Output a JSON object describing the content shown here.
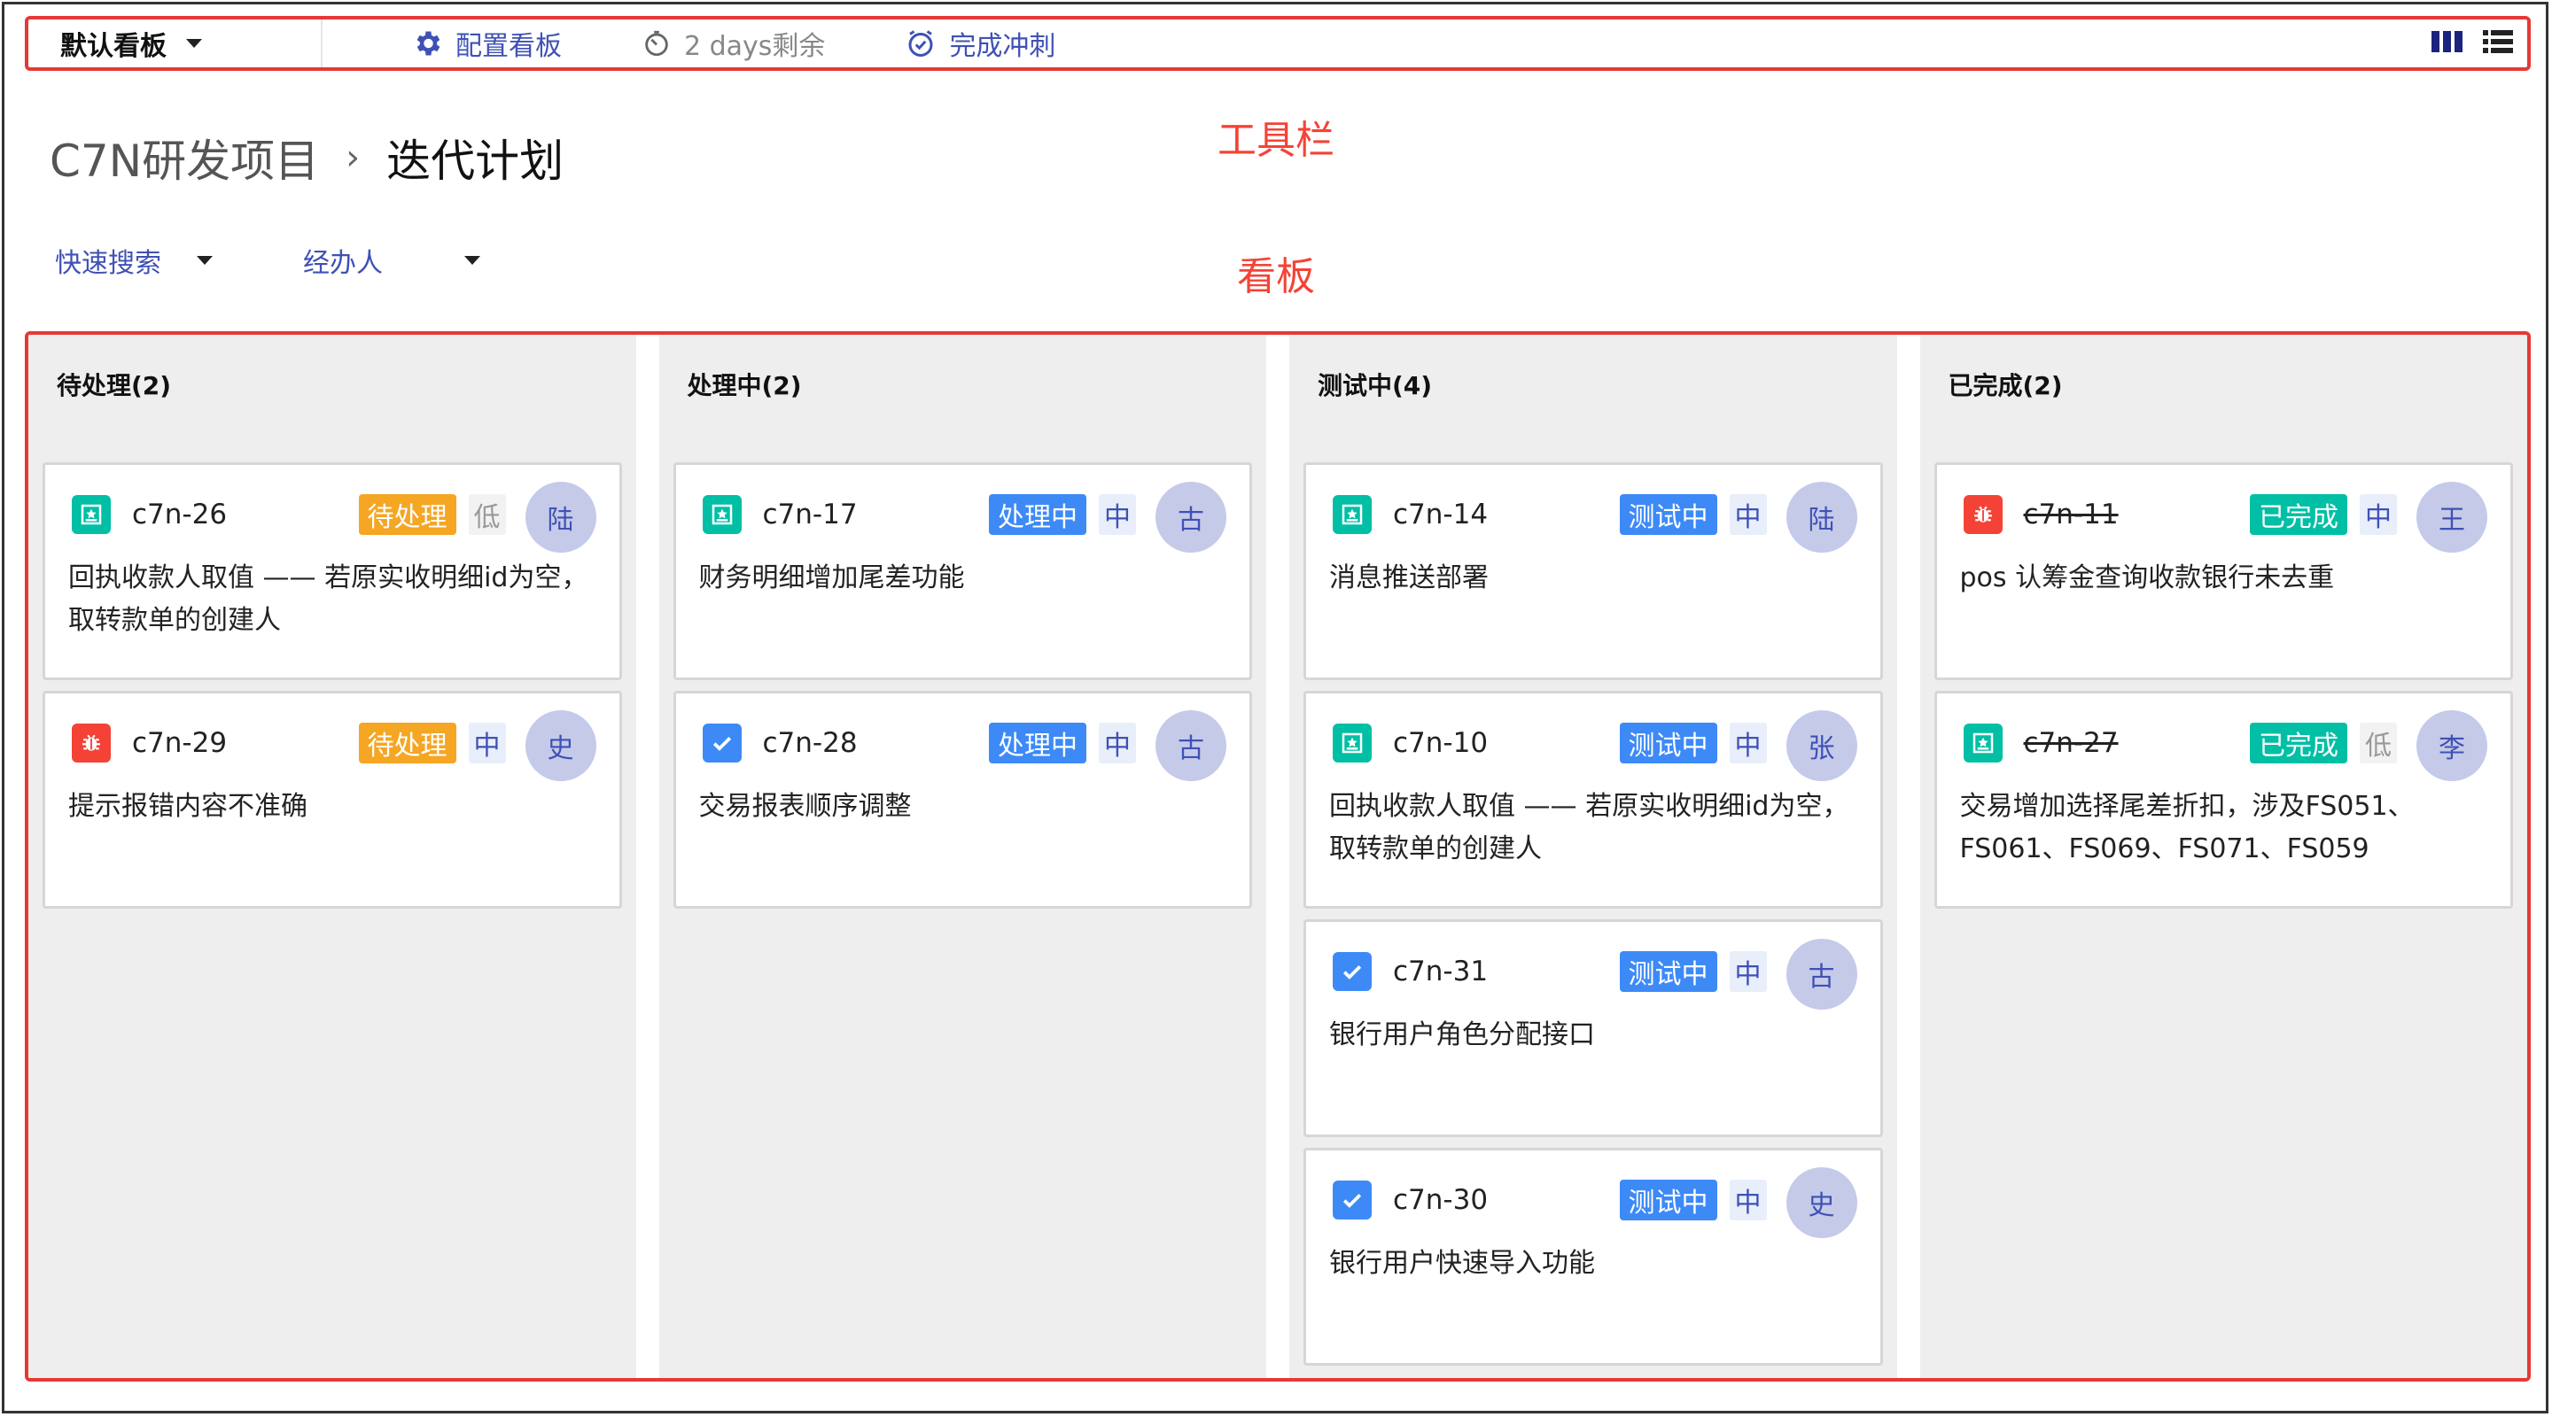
{
  "toolbar": {
    "board_select": "默认看板",
    "configure": "配置看板",
    "remaining": "2 days剩余",
    "complete_sprint": "完成冲刺"
  },
  "annotations": {
    "toolbar": "工具栏",
    "board": "看板"
  },
  "breadcrumb": {
    "project": "C7N研发项目",
    "separator": "›",
    "current": "迭代计划"
  },
  "filters": {
    "quick_search": "快速搜索",
    "assignee": "经办人"
  },
  "colors": {
    "pending": "#f5a623",
    "in_progress": "#3d8af7",
    "testing": "#3d8af7",
    "done": "#00bfa5",
    "story": "#00bfa5",
    "bug": "#f44336",
    "task": "#3d8af7",
    "accent": "#3f51b5"
  },
  "columns": [
    {
      "title": "待处理(2)",
      "cards": [
        {
          "type": "story",
          "key": "c7n-26",
          "status": "待处理",
          "status_color": "#f5a623",
          "priority": "低",
          "avatar": "陆",
          "summary": "回执收款人取值 —— 若原实收明细id为空，取转款单的创建人",
          "done": false
        },
        {
          "type": "bug",
          "key": "c7n-29",
          "status": "待处理",
          "status_color": "#f5a623",
          "priority": "中",
          "avatar": "史",
          "summary": "提示报错内容不准确",
          "done": false
        }
      ]
    },
    {
      "title": "处理中(2)",
      "cards": [
        {
          "type": "story",
          "key": "c7n-17",
          "status": "处理中",
          "status_color": "#3d8af7",
          "priority": "中",
          "avatar": "古",
          "summary": "财务明细增加尾差功能",
          "done": false
        },
        {
          "type": "task",
          "key": "c7n-28",
          "status": "处理中",
          "status_color": "#3d8af7",
          "priority": "中",
          "avatar": "古",
          "summary": "交易报表顺序调整",
          "done": false
        }
      ]
    },
    {
      "title": "测试中(4)",
      "cards": [
        {
          "type": "story",
          "key": "c7n-14",
          "status": "测试中",
          "status_color": "#3d8af7",
          "priority": "中",
          "avatar": "陆",
          "summary": "消息推送部署",
          "done": false
        },
        {
          "type": "story",
          "key": "c7n-10",
          "status": "测试中",
          "status_color": "#3d8af7",
          "priority": "中",
          "avatar": "张",
          "summary": "回执收款人取值 —— 若原实收明细id为空，取转款单的创建人",
          "done": false
        },
        {
          "type": "task",
          "key": "c7n-31",
          "status": "测试中",
          "status_color": "#3d8af7",
          "priority": "中",
          "avatar": "古",
          "summary": "银行用户角色分配接口",
          "done": false
        },
        {
          "type": "task",
          "key": "c7n-30",
          "status": "测试中",
          "status_color": "#3d8af7",
          "priority": "中",
          "avatar": "史",
          "summary": "银行用户快速导入功能",
          "done": false
        }
      ]
    },
    {
      "title": "已完成(2)",
      "cards": [
        {
          "type": "bug",
          "key": "c7n-11",
          "status": "已完成",
          "status_color": "#00bfa5",
          "priority": "中",
          "avatar": "王",
          "summary": "pos 认筹金查询收款银行未去重",
          "done": true
        },
        {
          "type": "story",
          "key": "c7n-27",
          "status": "已完成",
          "status_color": "#00bfa5",
          "priority": "低",
          "avatar": "李",
          "summary": "交易增加选择尾差折扣，涉及FS051、FS061、FS069、FS071、FS059",
          "done": true
        }
      ]
    }
  ]
}
